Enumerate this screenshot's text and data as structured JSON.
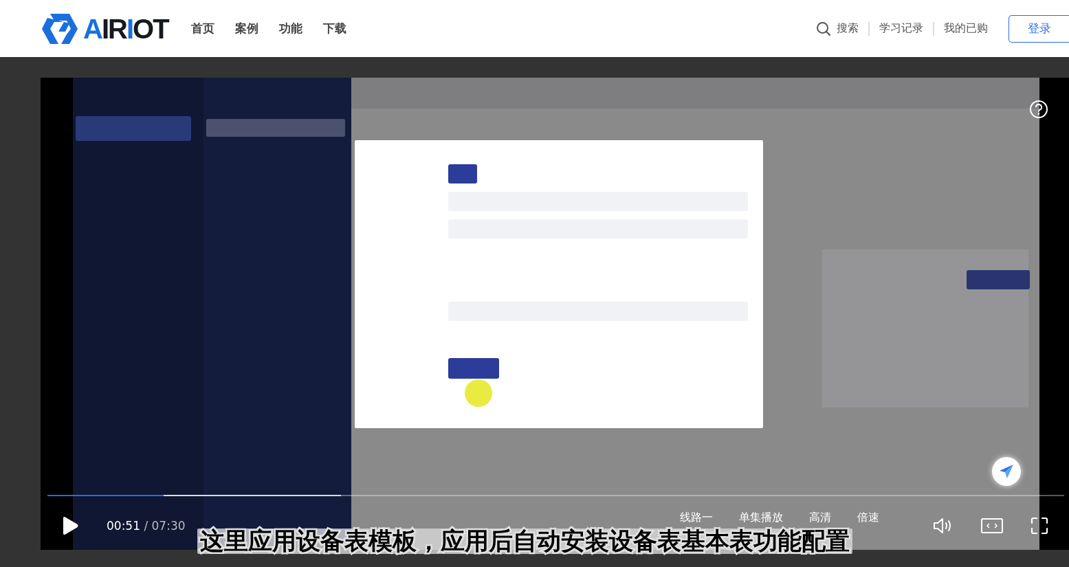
{
  "header": {
    "logo": [
      {
        "text": "A",
        "accent": true
      },
      {
        "text": "IR",
        "accent": false
      },
      {
        "text": "I",
        "accent": true
      },
      {
        "text": "OT",
        "accent": false
      }
    ],
    "nav": [
      {
        "label": "首页"
      },
      {
        "label": "案例"
      },
      {
        "label": "功能"
      },
      {
        "label": "下载"
      }
    ],
    "search": "搜索",
    "links": [
      "学习记录",
      "我的已购"
    ],
    "login": "登录"
  },
  "player": {
    "progress": {
      "level": 0.114
    },
    "playing": false,
    "time": "00:51",
    "duration": "/ 07:30",
    "options": [
      "线路一",
      "单集播放",
      "高清",
      "倍速"
    ],
    "subtitle": "这里应用设备表模板，应用后自动安装设备表基本表功能配置"
  }
}
